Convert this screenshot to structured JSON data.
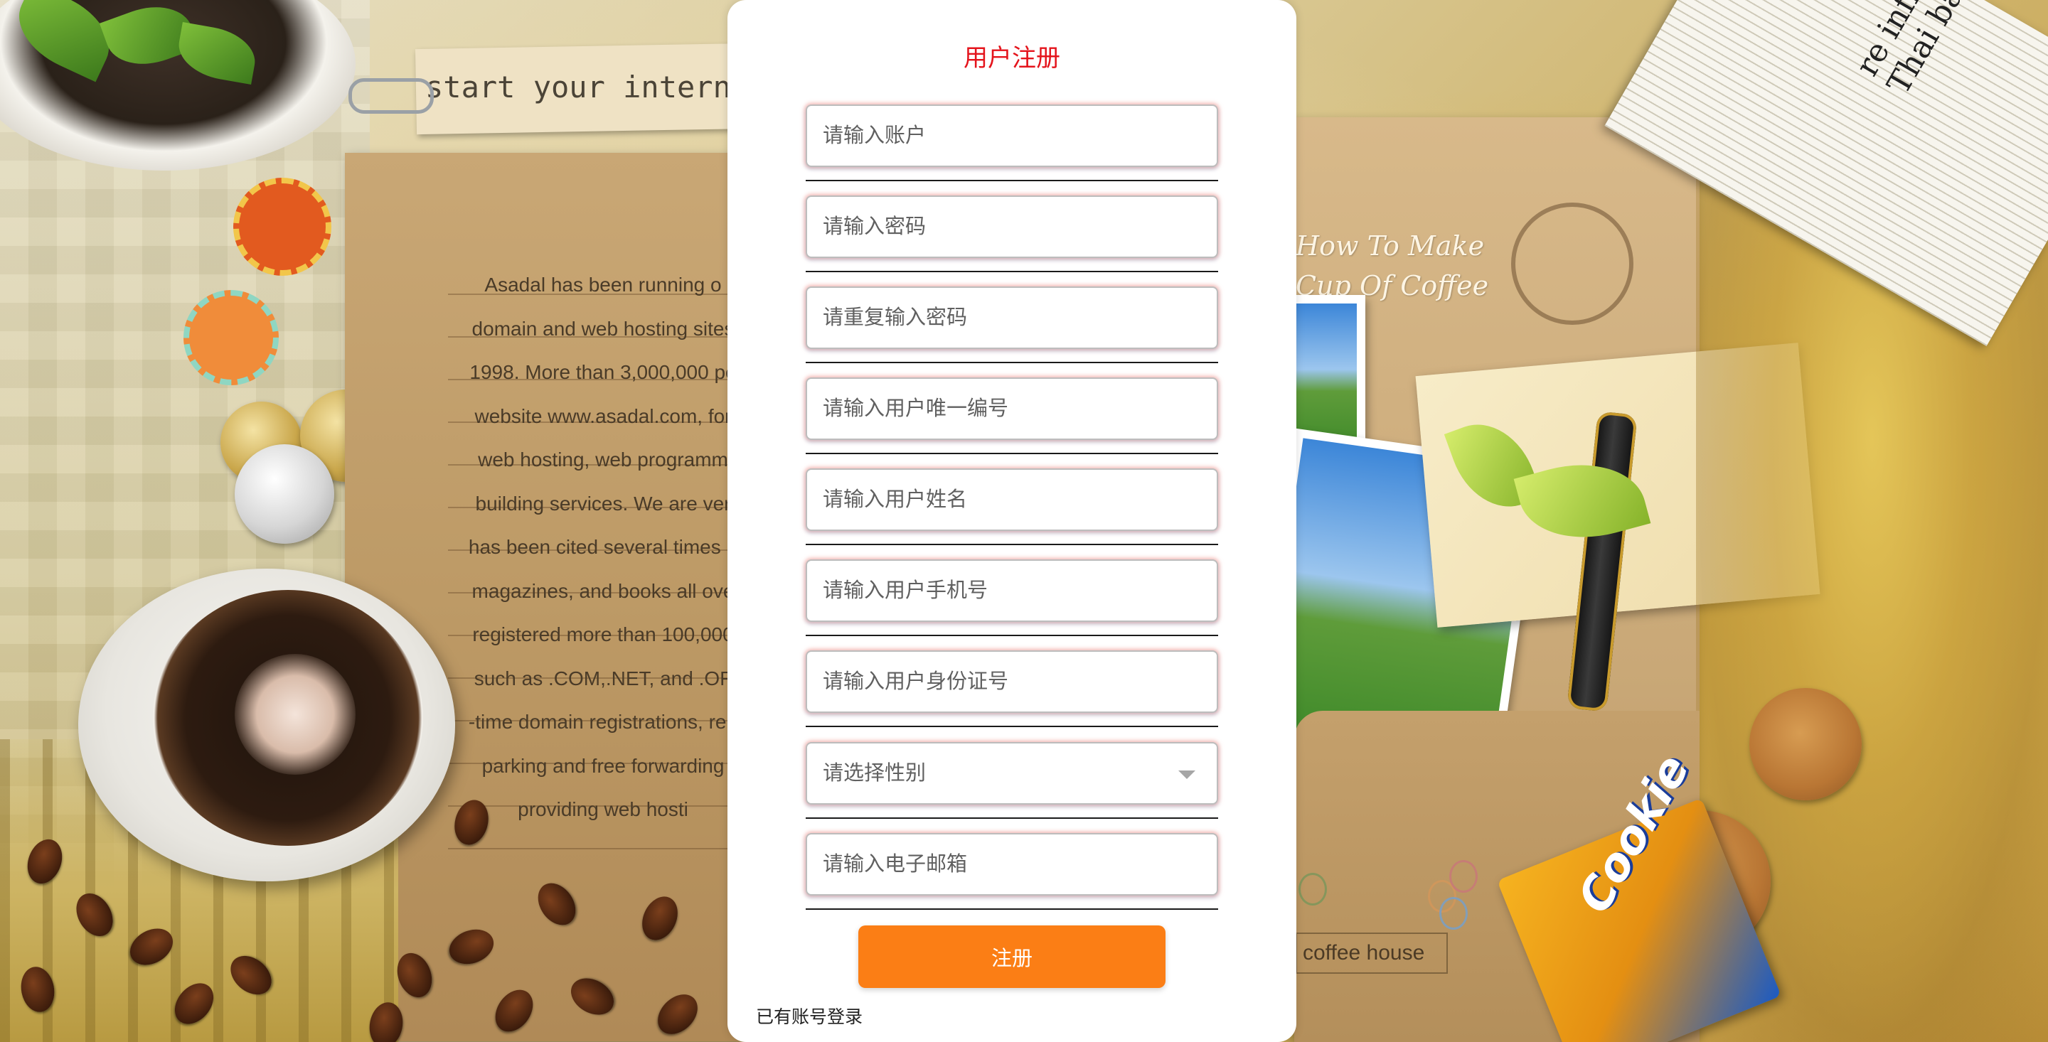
{
  "background": {
    "tag_text": "start your internet b",
    "note_lines": [
      "Asadal has been running o",
      "domain and web hosting sites",
      "1998. More than 3,000,000 pe",
      "website www.asadal.com, for",
      "web hosting, web programm",
      "building services. We are ver",
      "has been cited several times b",
      "magazines, and books all ove",
      "registered more than 100,000",
      "such as .COM,.NET, and .OF",
      "-time domain registrations, ren",
      "parking and free forwarding",
      "providing web hosti"
    ],
    "coffee_title_line1": "How To Make",
    "coffee_title_line2": "Cup Of Coffee",
    "coffee_house_sign": "coffee house",
    "newspaper_line1": "re inflows",
    "newspaper_line2": "Thai baht",
    "cookie_brand": "Cookie"
  },
  "form": {
    "title": "用户注册",
    "fields": [
      {
        "name": "account-input",
        "placeholder": "请输入账户",
        "value": ""
      },
      {
        "name": "password-input",
        "placeholder": "请输入密码",
        "value": ""
      },
      {
        "name": "confirm-password-input",
        "placeholder": "请重复输入密码",
        "value": ""
      },
      {
        "name": "user-id-input",
        "placeholder": "请输入用户唯一编号",
        "value": ""
      },
      {
        "name": "user-name-input",
        "placeholder": "请输入用户姓名",
        "value": ""
      },
      {
        "name": "phone-input",
        "placeholder": "请输入用户手机号",
        "value": ""
      },
      {
        "name": "id-card-input",
        "placeholder": "请输入用户身份证号",
        "value": ""
      }
    ],
    "gender_select": {
      "placeholder": "请选择性别",
      "selected": ""
    },
    "email_field": {
      "placeholder": "请输入电子邮箱",
      "value": ""
    },
    "submit_label": "注册",
    "login_link_label": "已有账号登录"
  },
  "colors": {
    "title": "#e4141c",
    "submit_button": "#fb7e15",
    "panel_background": "#ffffff"
  },
  "icons": {
    "gender_dropdown": "chevron-down-icon"
  }
}
